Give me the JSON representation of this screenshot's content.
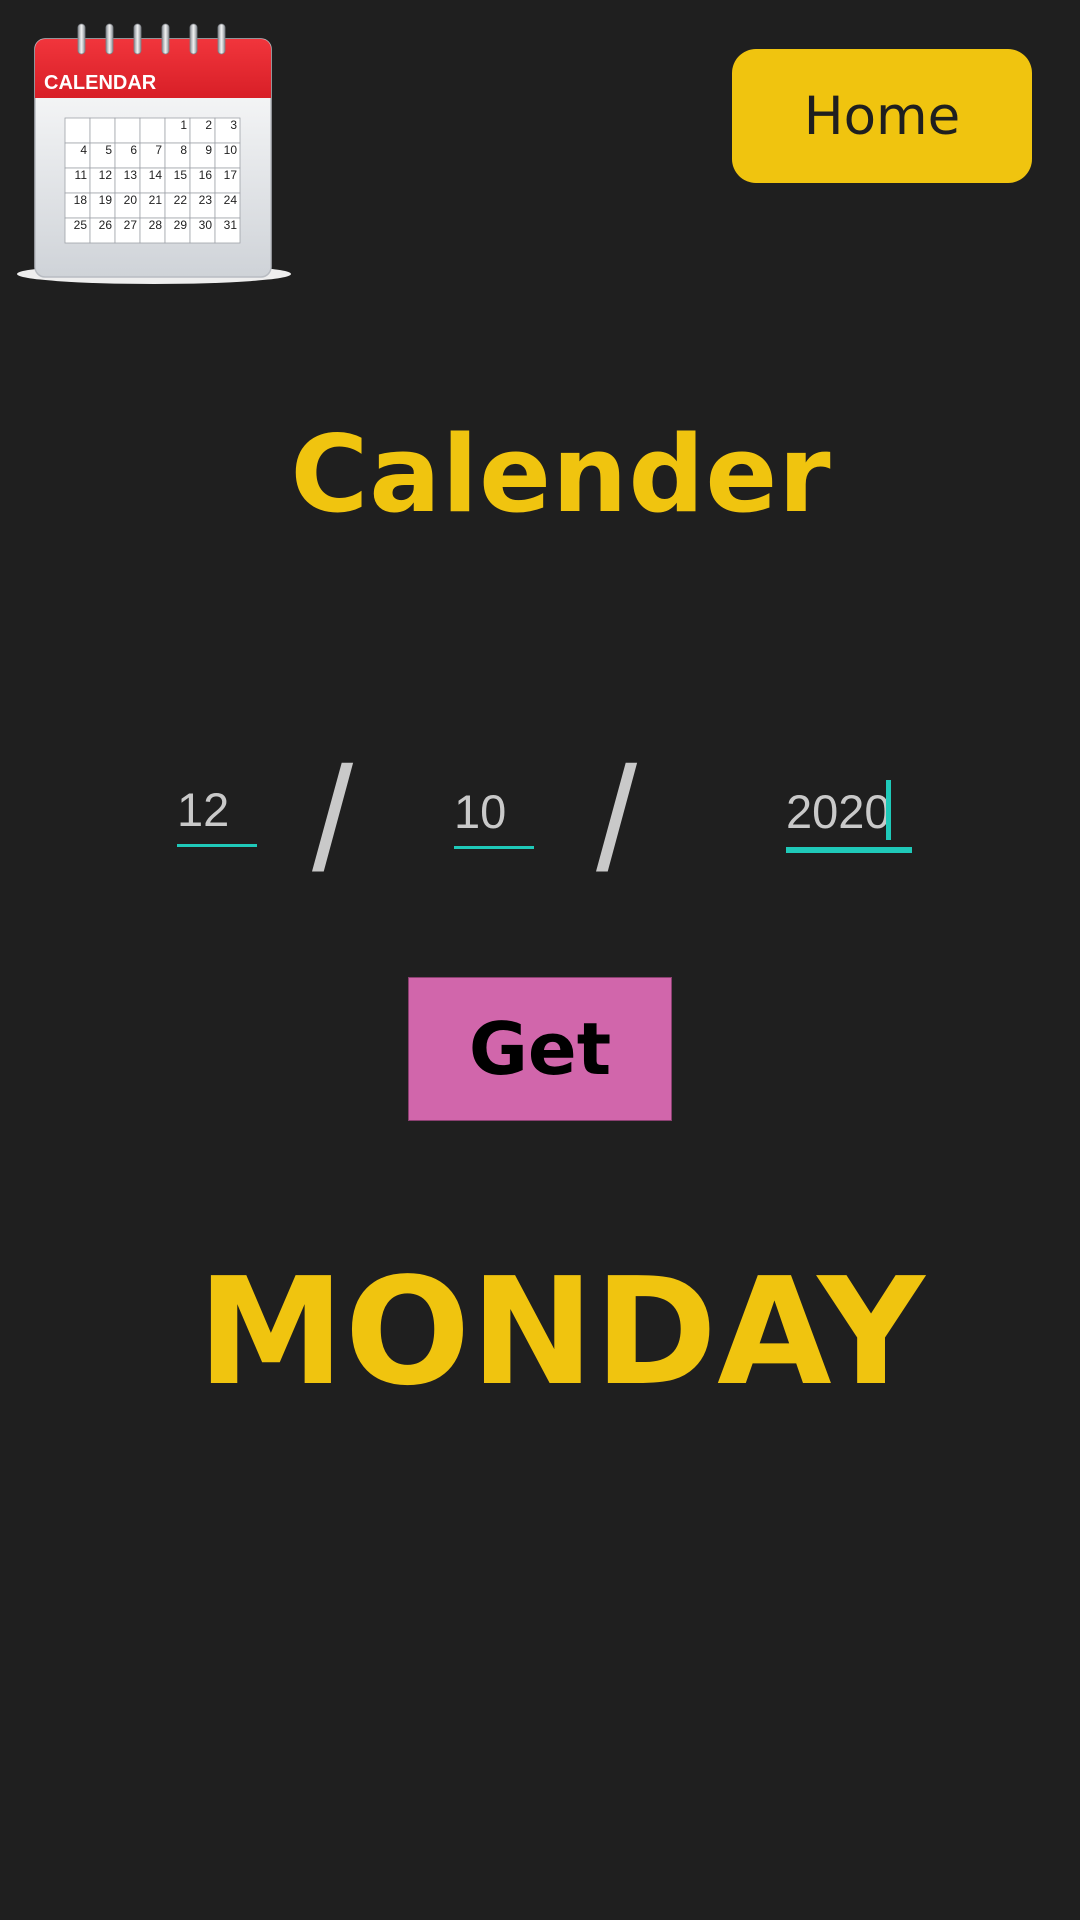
{
  "logo": {
    "label": "CALENDAR",
    "days": [
      [
        "",
        "",
        "",
        "",
        "1",
        "2",
        "3"
      ],
      [
        "4",
        "5",
        "6",
        "7",
        "8",
        "9",
        "10"
      ],
      [
        "11",
        "12",
        "13",
        "14",
        "15",
        "16",
        "17"
      ],
      [
        "18",
        "19",
        "20",
        "21",
        "22",
        "23",
        "24"
      ],
      [
        "25",
        "26",
        "27",
        "28",
        "29",
        "30",
        "31"
      ]
    ]
  },
  "header": {
    "home_label": "Home"
  },
  "title": "Calender",
  "date": {
    "day": "12",
    "month": "10",
    "year": "2020",
    "separator": "/"
  },
  "get_label": "Get",
  "result": "MONDAY",
  "colors": {
    "background": "#1f1f1f",
    "accent_yellow": "#f0c40f",
    "get_button": "#d166ab",
    "input_underline": "#1fc9b9",
    "input_text": "#c9c9c9",
    "logo_red": "#e8232b"
  }
}
